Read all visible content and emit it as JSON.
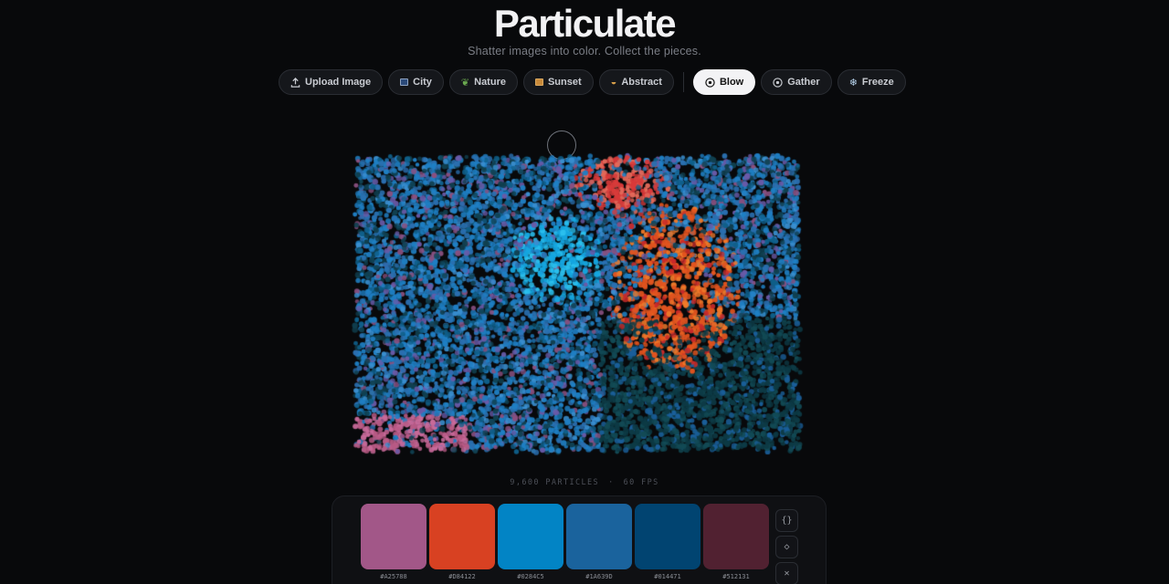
{
  "app": {
    "title": "Particulate",
    "subtitle": "Shatter images into color. Collect the pieces."
  },
  "toolbar": {
    "upload": {
      "label": "Upload Image",
      "icon": "upload-icon"
    },
    "presets": [
      {
        "label": "City",
        "icon": "city-icon"
      },
      {
        "label": "Nature",
        "icon": "leaf-icon"
      },
      {
        "label": "Sunset",
        "icon": "sunset-icon"
      },
      {
        "label": "Abstract",
        "icon": "palette-icon"
      }
    ],
    "modes": [
      {
        "label": "Blow",
        "icon": "target-icon",
        "active": true
      },
      {
        "label": "Gather",
        "icon": "target-icon",
        "active": false
      },
      {
        "label": "Freeze",
        "icon": "snowflake-icon",
        "active": false
      }
    ]
  },
  "stats": {
    "particles": "9,600 PARTICLES",
    "separator": "·",
    "fps": "60 FPS"
  },
  "palette": {
    "swatches": [
      {
        "hex": "#A25788",
        "color": "#A25788"
      },
      {
        "hex": "#D84122",
        "color": "#D84122"
      },
      {
        "hex": "#0284C5",
        "color": "#0284C5"
      },
      {
        "hex": "#1A639D",
        "color": "#1A639D"
      },
      {
        "hex": "#014471",
        "color": "#014471"
      },
      {
        "hex": "#512131",
        "color": "#512131"
      }
    ],
    "actions": [
      {
        "label": "{}",
        "icon": "braces-icon"
      },
      {
        "label": "◇",
        "icon": "diamond-icon"
      },
      {
        "label": "✕",
        "icon": "close-icon"
      }
    ]
  }
}
